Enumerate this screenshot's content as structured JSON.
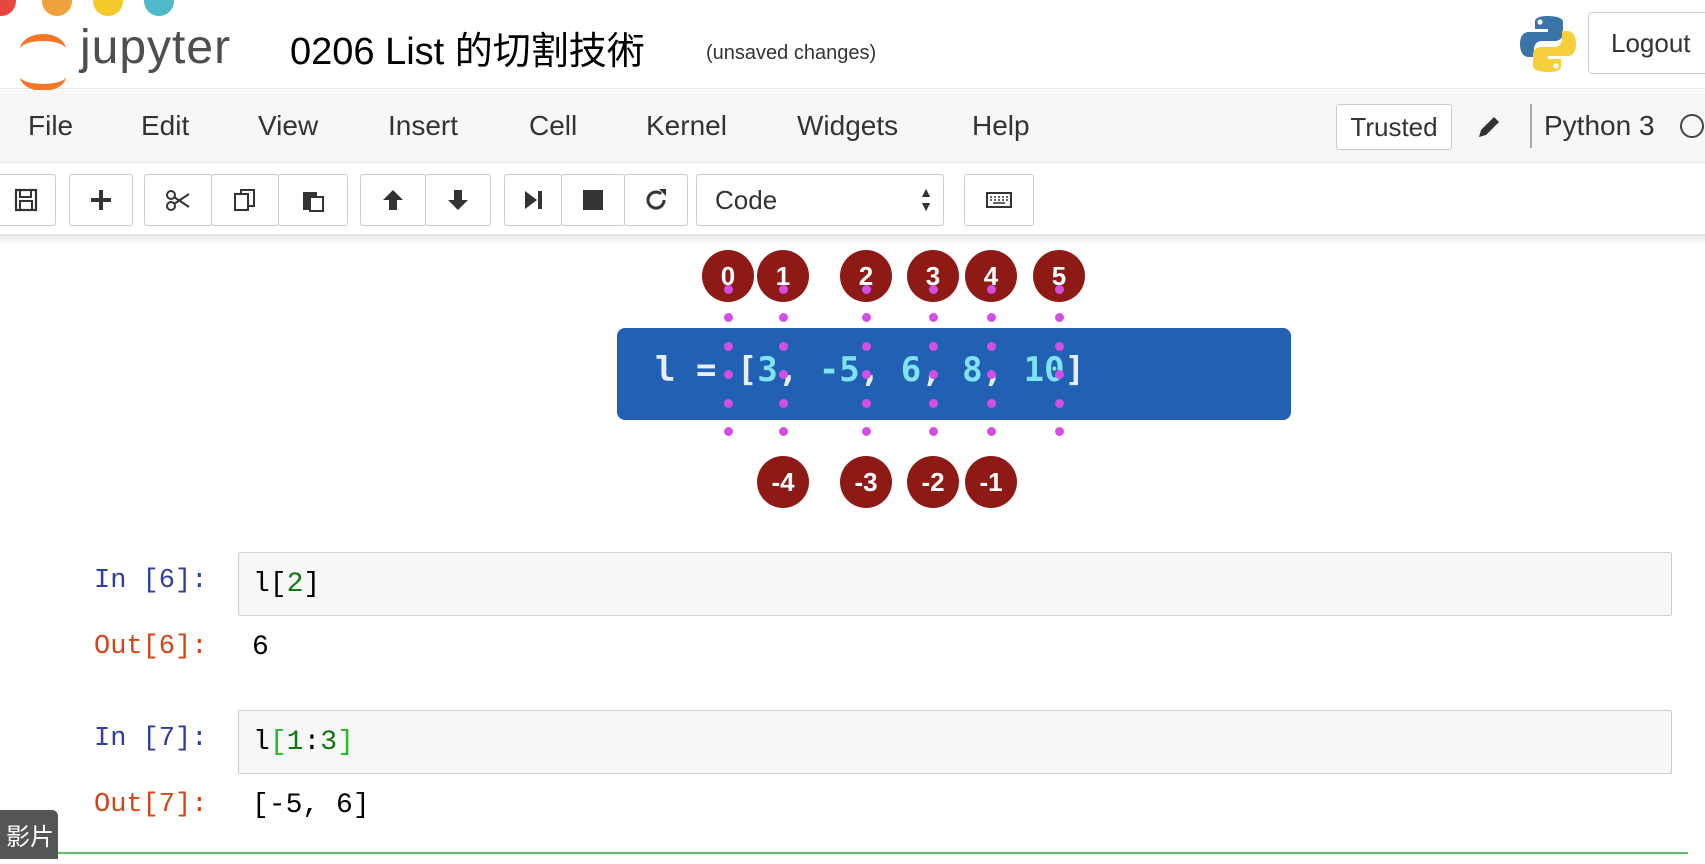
{
  "header": {
    "logo_text": "jupyter",
    "notebook_title": "0206 List 的切割技術",
    "save_status": "(unsaved changes)",
    "logout_label": "Logout"
  },
  "window_dots": [
    "#e8463f",
    "#f0a03c",
    "#f2cb2a",
    "#4fb8c9"
  ],
  "menubar": {
    "items": [
      "File",
      "Edit",
      "View",
      "Insert",
      "Cell",
      "Kernel",
      "Widgets",
      "Help"
    ],
    "trusted_label": "Trusted",
    "kernel_name": "Python 3"
  },
  "toolbar": {
    "buttons": [
      "save-icon",
      "plus-icon",
      "cut-icon",
      "copy-icon",
      "paste-icon",
      "arrow-up-icon",
      "arrow-down-icon",
      "step-forward-icon",
      "stop-icon",
      "restart-icon",
      "keyboard-icon"
    ],
    "cell_type": "Code"
  },
  "diagram": {
    "code_prefix": "l = ",
    "code_open": "[",
    "code_close": "]",
    "values": [
      "3",
      "-5",
      "6",
      "8",
      "10"
    ],
    "positive_indices": [
      "0",
      "1",
      "2",
      "3",
      "4",
      "5"
    ],
    "negative_indices": [
      "-4",
      "-3",
      "-2",
      "-1"
    ],
    "circle_color": "#8e1a16",
    "box_color": "#2260b3",
    "dot_color": "#d44ee6"
  },
  "cells": [
    {
      "in_prompt": "In [6]:",
      "code": "l[2]",
      "out_prompt": "Out[6]:",
      "output": "6"
    },
    {
      "in_prompt": "In [7]:",
      "code": "l[1:3]",
      "out_prompt": "Out[7]:",
      "output": "[-5, 6]"
    }
  ],
  "caption": "影片"
}
